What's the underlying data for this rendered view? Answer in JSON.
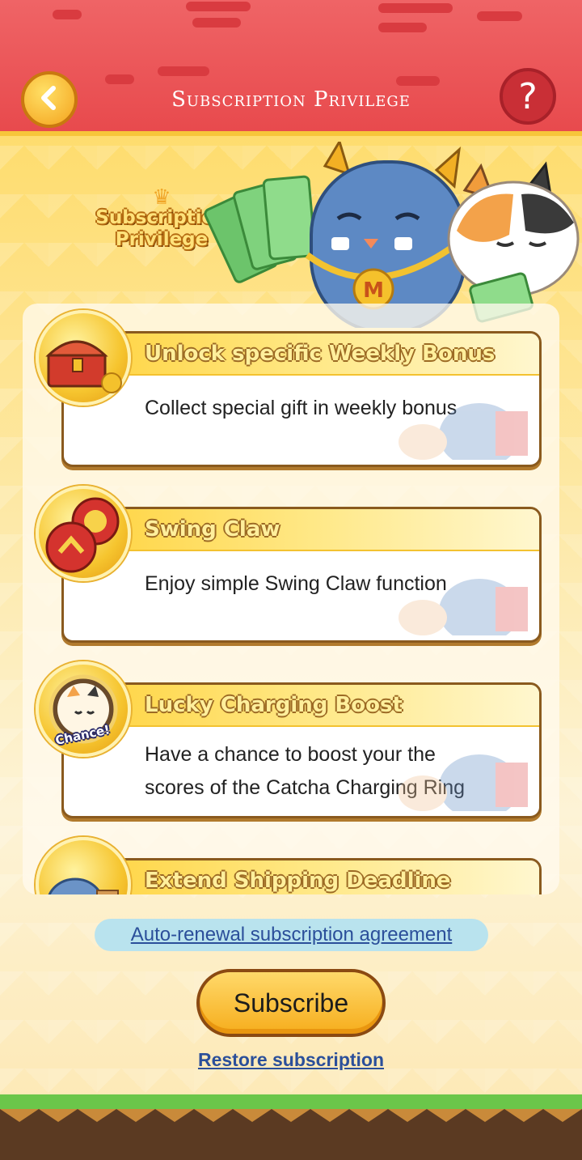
{
  "header": {
    "title": "Subscription Privilege",
    "back_icon": "chevron-left-icon",
    "help_label": "?"
  },
  "hero": {
    "logo_line1": "Subscription",
    "logo_line2": "Privilege"
  },
  "privileges": [
    {
      "title": "Unlock specific Weekly Bonus",
      "desc_lines": [
        "Collect special gift in weekly bonus"
      ],
      "icon": "treasure-chest-icon"
    },
    {
      "title": "Swing Claw",
      "desc_lines": [
        "Enjoy simple Swing Claw function"
      ],
      "icon": "claw-chip-icon"
    },
    {
      "title": "Lucky Charging Boost",
      "desc_lines": [
        "Have a chance to boost your the",
        "scores of the Catcha Charging Ring"
      ],
      "icon": "chance-cat-icon",
      "badge_text": "Chance!"
    },
    {
      "title": "Extend Shipping Deadline",
      "desc_lines": [],
      "icon": "delivery-icon"
    }
  ],
  "footer": {
    "agreement_link": "Auto-renewal subscription agreement",
    "subscribe_label": "Subscribe",
    "restore_link": "Restore subscription"
  },
  "colors": {
    "header_red": "#e84a4d",
    "accent_yellow": "#f6ad1c",
    "link_blue": "#2b4f9a"
  }
}
